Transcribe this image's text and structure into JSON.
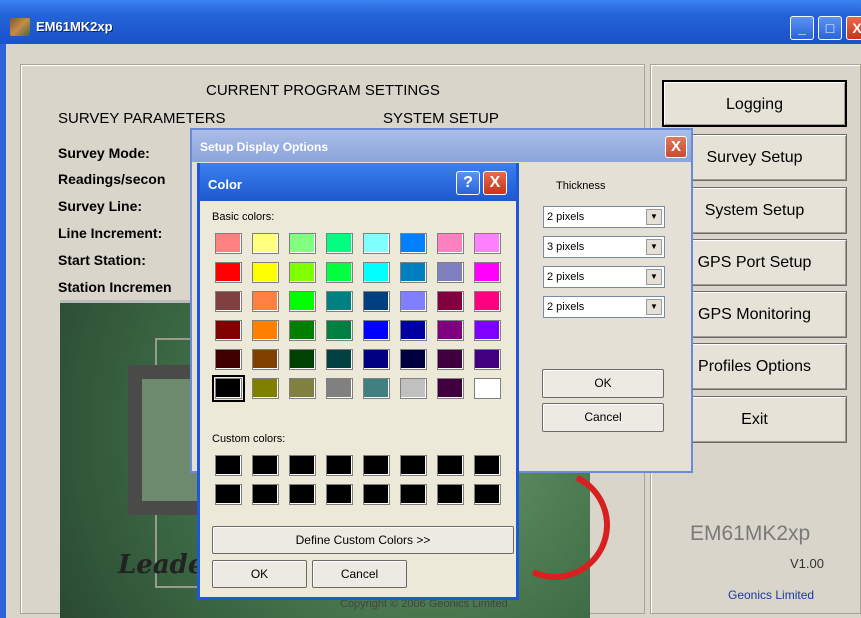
{
  "window": {
    "title": "EM61MK2xp",
    "controls": {
      "minimize": "_",
      "maximize": "□",
      "close": "X"
    }
  },
  "settings": {
    "header": "CURRENT PROGRAM SETTINGS",
    "survey_parameters": "SURVEY PARAMETERS",
    "system_setup": "SYSTEM SETUP",
    "rows": [
      "Survey Mode:",
      "Readings/secon",
      "Survey Line:",
      "Line Increment:",
      "Start Station:",
      "Station Incremen"
    ]
  },
  "menu_buttons": [
    "Logging",
    "Survey Setup",
    "System Setup",
    "GPS Port Setup",
    "GPS Monitoring",
    "Profiles Options",
    "Exit"
  ],
  "logo_panel": {
    "leader_text": "Leader",
    "copyright": "Copyright © 2006 Geonics Limited"
  },
  "app_info": {
    "name": "EM61MK2xp",
    "version": "V1.00",
    "company": "Geonics Limited"
  },
  "setup_display_dialog": {
    "title": "Setup Display Options",
    "close": "X",
    "thickness_label": "Thickness",
    "thickness_values": [
      "2 pixels",
      "3 pixels",
      "2 pixels",
      "2 pixels"
    ],
    "ok_label": "OK",
    "cancel_label": "Cancel"
  },
  "color_dialog": {
    "title": "Color",
    "help": "?",
    "close": "X",
    "basic_colors_label": "Basic colors:",
    "custom_colors_label": "Custom colors:",
    "basic_colors": [
      [
        "#ff8080",
        "#ffff80",
        "#80ff80",
        "#00ff80",
        "#80ffff",
        "#0080ff",
        "#ff80c0",
        "#ff80ff"
      ],
      [
        "#ff0000",
        "#ffff00",
        "#80ff00",
        "#00ff40",
        "#00ffff",
        "#0080c0",
        "#8080c0",
        "#ff00ff"
      ],
      [
        "#804040",
        "#ff8040",
        "#00ff00",
        "#008080",
        "#004080",
        "#8080ff",
        "#800040",
        "#ff0080"
      ],
      [
        "#800000",
        "#ff8000",
        "#008000",
        "#008040",
        "#0000ff",
        "#0000a0",
        "#800080",
        "#8000ff"
      ],
      [
        "#400000",
        "#804000",
        "#004000",
        "#004040",
        "#000080",
        "#000040",
        "#400040",
        "#400080"
      ],
      [
        "#000000",
        "#808000",
        "#808040",
        "#808080",
        "#408080",
        "#c0c0c0",
        "#400040",
        "#ffffff"
      ]
    ],
    "selected_color": "#000000",
    "custom_colors": [
      [
        "#000000",
        "#000000",
        "#000000",
        "#000000",
        "#000000",
        "#000000",
        "#000000",
        "#000000"
      ],
      [
        "#000000",
        "#000000",
        "#000000",
        "#000000",
        "#000000",
        "#000000",
        "#000000",
        "#000000"
      ]
    ],
    "define_custom_label": "Define Custom Colors >>",
    "ok_label": "OK",
    "cancel_label": "Cancel"
  }
}
